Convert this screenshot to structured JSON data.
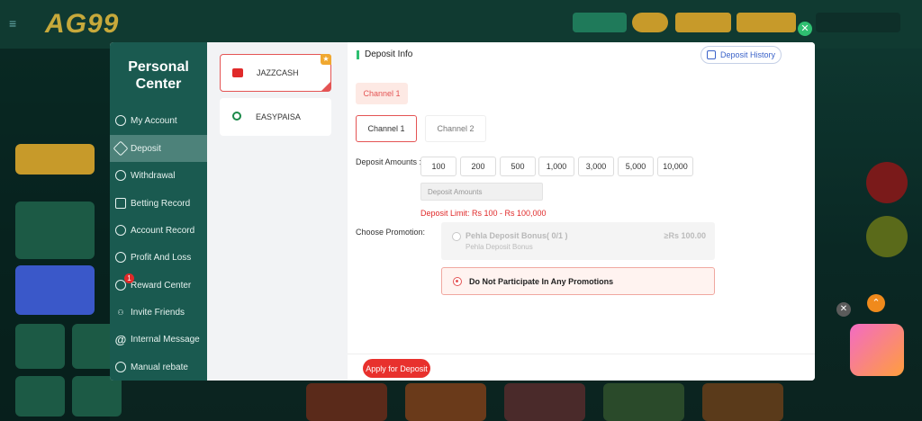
{
  "app": {
    "logo": "AG99"
  },
  "sidebar": {
    "title_line1": "Personal",
    "title_line2": "Center",
    "items": [
      {
        "label": "My Account",
        "icon": "user-circle-icon"
      },
      {
        "label": "Deposit",
        "icon": "tag-icon",
        "active": true
      },
      {
        "label": "Withdrawal",
        "icon": "bar-chart-icon"
      },
      {
        "label": "Betting Record",
        "icon": "document-icon"
      },
      {
        "label": "Account Record",
        "icon": "list-icon"
      },
      {
        "label": "Profit And Loss",
        "icon": "pl-icon"
      },
      {
        "label": "Reward Center",
        "icon": "reward-icon",
        "badge": "1"
      },
      {
        "label": "Invite Friends",
        "icon": "invite-icon"
      },
      {
        "label": "Internal Message",
        "icon": "at-icon"
      },
      {
        "label": "Manual rebate",
        "icon": "rebate-icon"
      }
    ]
  },
  "methods": [
    {
      "label": "JAZZCASH",
      "selected": true
    },
    {
      "label": "EASYPAISA",
      "selected": false
    }
  ],
  "content": {
    "header": "Deposit Info",
    "history_button": "Deposit History",
    "channel_tag": "Channel 1",
    "channels": [
      "Channel 1",
      "Channel 2"
    ],
    "deposit_amounts_label": "Deposit Amounts :",
    "amounts": [
      "100",
      "200",
      "500",
      "1,000",
      "3,000",
      "5,000",
      "10,000"
    ],
    "amount_placeholder": "Deposit Amounts",
    "limit_text": "Deposit Limit:  Rs  100  -  Rs  100,000",
    "promotion_label": "Choose Promotion:",
    "promotions": [
      {
        "title": "Pehla Deposit Bonus( 0/1 )",
        "subtitle": "Pehla Deposit Bonus",
        "amount": "≥Rs  100.00",
        "selected": false
      },
      {
        "title": "Do Not Participate In Any Promotions",
        "selected": true
      }
    ],
    "apply_button": "Apply for Deposit"
  },
  "colors": {
    "sidebar_bg": "#1a5a50",
    "accent_red": "#e45454",
    "apply_red": "#e8312d",
    "link_blue": "#3b63c9"
  }
}
